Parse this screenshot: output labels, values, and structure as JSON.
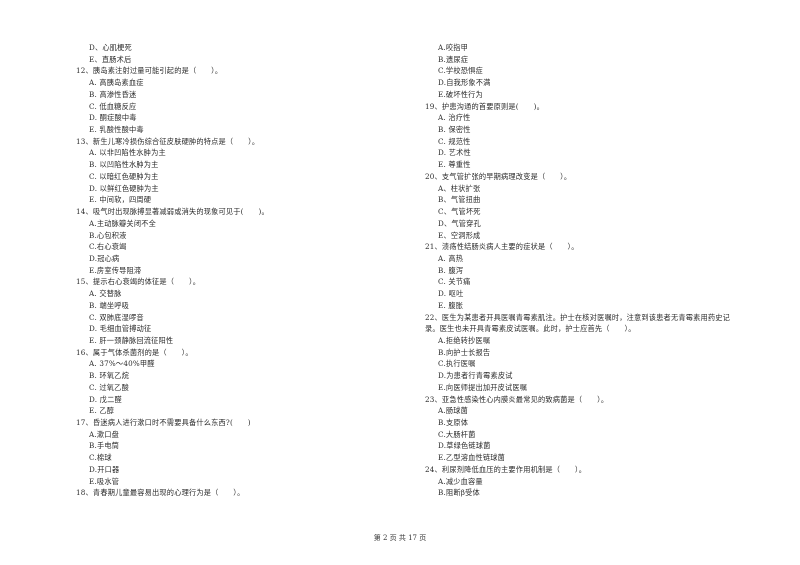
{
  "page": {
    "footer": "第 2 页 共 17 页"
  },
  "left_column": [
    {
      "type": "opt",
      "text": "D、心肌梗死"
    },
    {
      "type": "opt",
      "text": "E、直肠术后"
    },
    {
      "type": "q",
      "text": "12、胰岛素注射过量可能引起的是（　　）。"
    },
    {
      "type": "opt",
      "text": "A. 高胰岛素血症"
    },
    {
      "type": "opt",
      "text": "B. 高渗性昏迷"
    },
    {
      "type": "opt",
      "text": "C. 低血糖反应"
    },
    {
      "type": "opt",
      "text": "D. 酮症酸中毒"
    },
    {
      "type": "opt",
      "text": "E. 乳酸性酸中毒"
    },
    {
      "type": "q",
      "text": "13、新生儿寒冷损伤综合征皮肤硬肿的特点是（　　）。"
    },
    {
      "type": "opt",
      "text": "A. 以非凹陷性水肿为主"
    },
    {
      "type": "opt",
      "text": "B. 以凹陷性水肿为主"
    },
    {
      "type": "opt",
      "text": "C. 以暗红色硬肿为主"
    },
    {
      "type": "opt",
      "text": "D. 以鲜红色硬肿为主"
    },
    {
      "type": "opt",
      "text": "E. 中间软，四周硬"
    },
    {
      "type": "q",
      "text": "14、吸气时出现脉搏显著减弱或消失的现象可见于(　　)。"
    },
    {
      "type": "opt",
      "text": "A.主动脉瓣关闭不全"
    },
    {
      "type": "opt",
      "text": "B.心包积液"
    },
    {
      "type": "opt",
      "text": "C.右心衰竭"
    },
    {
      "type": "opt",
      "text": "D.冠心病"
    },
    {
      "type": "opt",
      "text": "E.房室传导阻滞"
    },
    {
      "type": "q",
      "text": "15、提示右心衰竭的体征是（　　）。"
    },
    {
      "type": "opt",
      "text": "A. 交替脉"
    },
    {
      "type": "opt",
      "text": "B. 端坐呼吸"
    },
    {
      "type": "opt",
      "text": "C. 双肺底湿啰音"
    },
    {
      "type": "opt",
      "text": "D. 毛细血管搏动征"
    },
    {
      "type": "opt",
      "text": "E. 肝一颈静脉回流征阳性"
    },
    {
      "type": "q",
      "text": "16、属于气体杀菌剂的是（　　）。"
    },
    {
      "type": "opt",
      "text": "A. 37%～40%甲醛"
    },
    {
      "type": "opt",
      "text": "B. 环氧乙烷"
    },
    {
      "type": "opt",
      "text": "C. 过氧乙酸"
    },
    {
      "type": "opt",
      "text": "D. 戊二醛"
    },
    {
      "type": "opt",
      "text": "E. 乙醇"
    },
    {
      "type": "q",
      "text": "17、昏迷病人进行漱口时不需要具备什么东西?(　　)"
    },
    {
      "type": "opt",
      "text": "A.漱口盘"
    },
    {
      "type": "opt",
      "text": "B.手电筒"
    },
    {
      "type": "opt",
      "text": "C.棉球"
    },
    {
      "type": "opt",
      "text": "D.开口器"
    },
    {
      "type": "opt",
      "text": "E.吸水管"
    },
    {
      "type": "q",
      "text": "18、青春期儿童最容易出现的心理行为是（　　）。"
    }
  ],
  "right_column": [
    {
      "type": "opt",
      "text": "A.咬指甲"
    },
    {
      "type": "opt",
      "text": "B.遗尿症"
    },
    {
      "type": "opt",
      "text": "C.学校恐惧症"
    },
    {
      "type": "opt",
      "text": "D.自我形象不满"
    },
    {
      "type": "opt",
      "text": "E.破坏性行为"
    },
    {
      "type": "q",
      "text": "19、护患沟通的首要原则是(　　)。"
    },
    {
      "type": "opt",
      "text": "A. 治疗性"
    },
    {
      "type": "opt",
      "text": "B. 保密性"
    },
    {
      "type": "opt",
      "text": "C. 规范性"
    },
    {
      "type": "opt",
      "text": "D. 艺术性"
    },
    {
      "type": "opt",
      "text": "E. 尊重性"
    },
    {
      "type": "q",
      "text": "20、支气管扩张的早期病理改变是（　　）。"
    },
    {
      "type": "opt",
      "text": "A、柱状扩张"
    },
    {
      "type": "opt",
      "text": "B、气管扭曲"
    },
    {
      "type": "opt",
      "text": "C、气管坏死"
    },
    {
      "type": "opt",
      "text": "D、气管穿孔"
    },
    {
      "type": "opt",
      "text": "E、空洞形成"
    },
    {
      "type": "q",
      "text": "21、溃疡性结肠炎病人主要的症状是（　　）。"
    },
    {
      "type": "opt",
      "text": "A. 高热"
    },
    {
      "type": "opt",
      "text": "B. 腹泻"
    },
    {
      "type": "opt",
      "text": "C. 关节痛"
    },
    {
      "type": "opt",
      "text": "D. 呕吐"
    },
    {
      "type": "opt",
      "text": "E. 腹胀"
    },
    {
      "type": "q",
      "text": "22、医生为某患者开具医嘱青霉素肌注。护士在核对医嘱时，注意到该患者无青霉素用药史记"
    },
    {
      "type": "cont",
      "text": "录。医生也未开具青霉素皮试医嘱。此时，护士应首先（　　）。"
    },
    {
      "type": "opt",
      "text": "A.拒绝转抄医嘱"
    },
    {
      "type": "opt",
      "text": "B.向护士长报告"
    },
    {
      "type": "opt",
      "text": "C.执行医嘱"
    },
    {
      "type": "opt",
      "text": "D.为患者行青霉素皮试"
    },
    {
      "type": "opt",
      "text": "E.向医师提出加开皮试医嘱"
    },
    {
      "type": "q",
      "text": "23、亚急性感染性心内膜炎最常见的致病菌是（　　）。"
    },
    {
      "type": "opt",
      "text": "A.肠球菌"
    },
    {
      "type": "opt",
      "text": "B.支原体"
    },
    {
      "type": "opt",
      "text": "C.大肠杆菌"
    },
    {
      "type": "opt",
      "text": "D.草绿色链球菌"
    },
    {
      "type": "opt",
      "text": "E.乙型溶血性链球菌"
    },
    {
      "type": "q",
      "text": "24、利尿剂降低血压的主要作用机制是（　　）。"
    },
    {
      "type": "opt",
      "text": "A.减少血容量"
    },
    {
      "type": "opt",
      "text": "B.阻断β受体"
    }
  ]
}
